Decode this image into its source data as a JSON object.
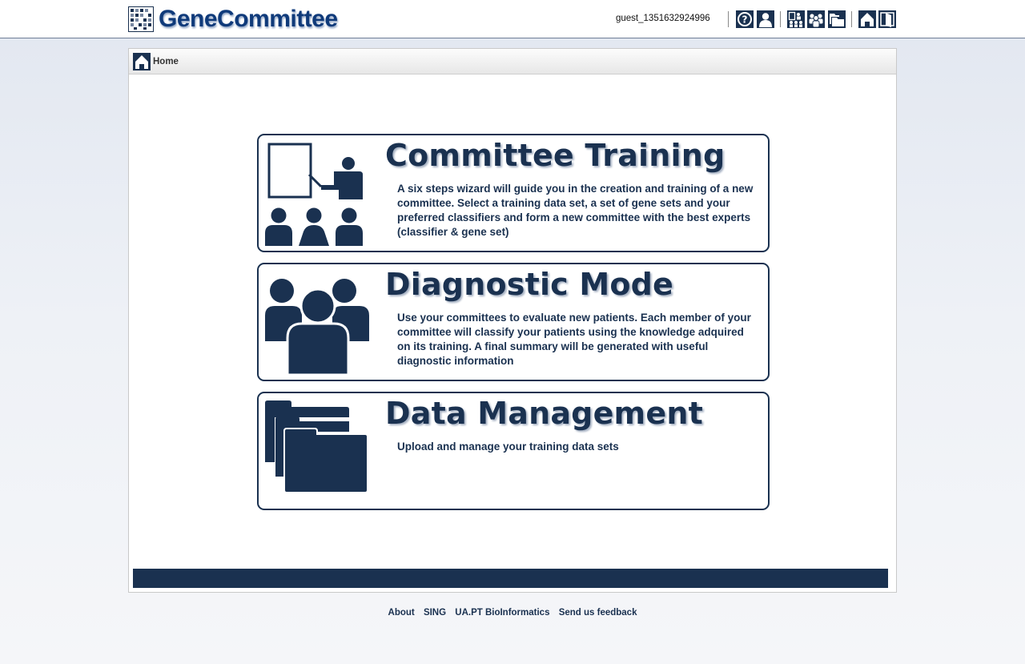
{
  "app": {
    "name": "GeneCommittee"
  },
  "user": {
    "name": "guest_1351632924996"
  },
  "toolbar": {
    "icons": [
      "help-icon",
      "user-profile-icon",
      "committees-icon",
      "patients-icon",
      "datasets-icon",
      "home-icon",
      "logout-icon"
    ]
  },
  "breadcrumb": {
    "label": "Home"
  },
  "cards": {
    "training": {
      "title": "Committee Training",
      "description": "A six steps wizard will guide you in the creation and training of a new committee. Select a training data set, a set of gene sets and your preferred classifiers and form a new committee with the best experts (classifier & gene set)"
    },
    "diagnostic": {
      "title": "Diagnostic Mode",
      "description": "Use your committees to evaluate new patients. Each member of your committee will classify your patients using the knowledge adquired on its training. A final summary will be generated with useful diagnostic information"
    },
    "data": {
      "title": "Data Management",
      "description": "Upload and manage your training data sets"
    }
  },
  "footer": {
    "links": [
      "About",
      "SING",
      "UA.PT BioInformatics",
      "Send us feedback"
    ]
  },
  "colors": {
    "primary": "#1a3150",
    "logo": "#0f3a7a"
  }
}
